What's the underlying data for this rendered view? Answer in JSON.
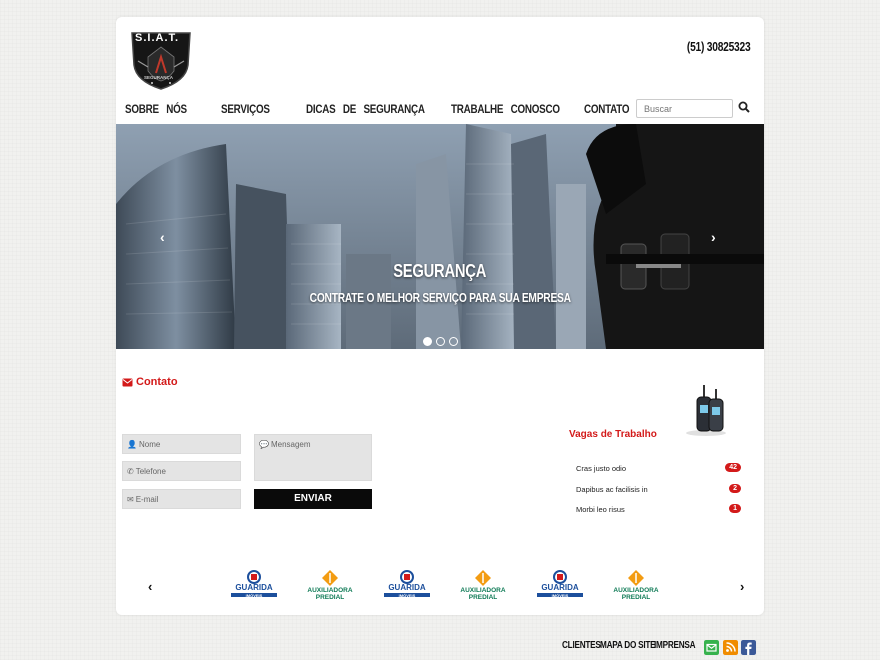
{
  "header": {
    "logo_text": "S.I.A.T.",
    "logo_sub": "SEGURANÇA",
    "phone": "(51) 30825323"
  },
  "nav": {
    "items": [
      {
        "label": "SOBRE   NÓS"
      },
      {
        "label": "SERVIÇOS"
      },
      {
        "label": "DICAS   DE   SEGURANÇA"
      },
      {
        "label": "TRABALHE   CONOSCO"
      },
      {
        "label": "CONTATO"
      }
    ],
    "search_placeholder": "Buscar"
  },
  "slider": {
    "title": "SEGURANÇA",
    "subtitle": "CONTRATE O MELHOR SERVIÇO PARA SUA EMPRESA",
    "prev": "‹",
    "next": "›",
    "active_dot": 1,
    "dot_count": 3
  },
  "contact": {
    "heading": "Contato",
    "name_placeholder": "Nome",
    "phone_placeholder": "Telefone",
    "email_placeholder": "E-mail",
    "message_placeholder": "Mensagem",
    "send_label": "ENVIAR"
  },
  "jobs": {
    "heading": "Vagas de Trabalho",
    "items": [
      {
        "label": "Cras justo odio",
        "count": "42"
      },
      {
        "label": "Dapibus ac facilisis in",
        "count": "2"
      },
      {
        "label": "Morbi leo risus",
        "count": "1"
      }
    ]
  },
  "clients": {
    "prev": "‹",
    "next": "›",
    "logos": [
      {
        "name": "GUARIDA",
        "sub": "IMÓVEIS",
        "kind": "guarida"
      },
      {
        "name": "AUXILIADORA",
        "sub": "PREDIAL",
        "kind": "auxiliadora"
      },
      {
        "name": "GUARIDA",
        "sub": "IMÓVEIS",
        "kind": "guarida"
      },
      {
        "name": "AUXILIADORA",
        "sub": "PREDIAL",
        "kind": "auxiliadora"
      },
      {
        "name": "GUARIDA",
        "sub": "IMÓVEIS",
        "kind": "guarida"
      },
      {
        "name": "AUXILIADORA",
        "sub": "PREDIAL",
        "kind": "auxiliadora"
      }
    ]
  },
  "footer": {
    "links": [
      "CLIENTES",
      "MAPA DO SITE",
      "IMPRENSA"
    ],
    "social": [
      {
        "icon": "email-icon",
        "color": "#37b24d"
      },
      {
        "icon": "rss-icon",
        "color": "#f08c00"
      },
      {
        "icon": "facebook-icon",
        "color": "#3b5998"
      }
    ]
  },
  "colors": {
    "accent": "#d31a1a",
    "button": "#0a0a0a"
  }
}
